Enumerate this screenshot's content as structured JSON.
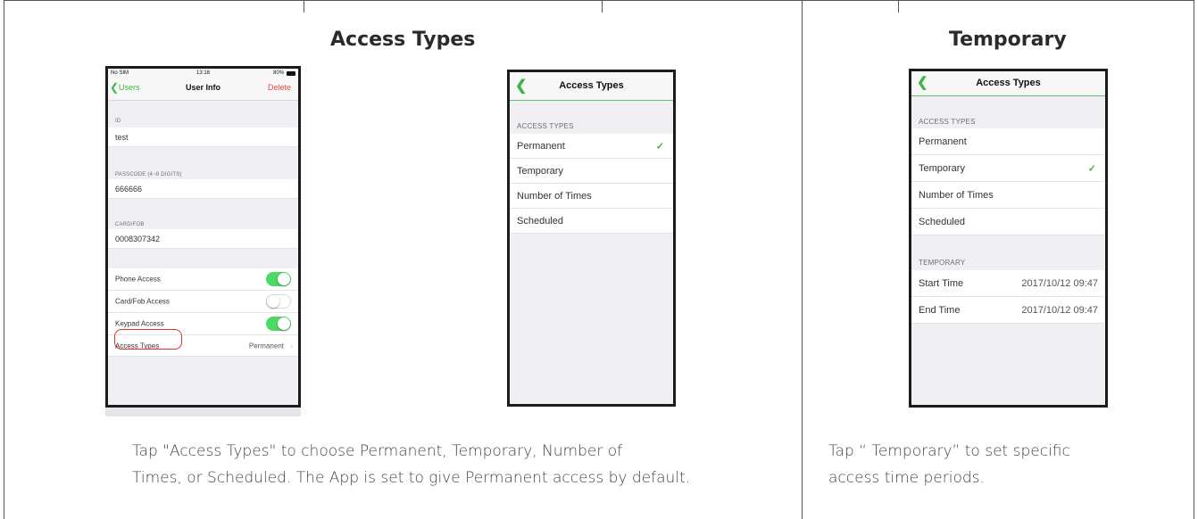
{
  "left_section": {
    "title": "Access Types",
    "caption_line1": "Tap \"Access Types\" to choose Permanent, Temporary, Number of",
    "caption_line2": "Times, or Scheduled. The App is set to give Permanent access by default.",
    "phone1": {
      "status_carrier": "No SIM",
      "status_time": "13:18",
      "status_battery": "80%",
      "nav_back": "Users",
      "nav_title": "User Info",
      "nav_action": "Delete",
      "id_header": "ID",
      "id_value": "test",
      "passcode_header": "PASSCODE (4~8 DIGITS)",
      "passcode_value": "666666",
      "card_header": "CARD/FOB",
      "card_value": "0008307342",
      "phone_access": "Phone Access",
      "card_access": "Card/Fob Access",
      "keypad_access": "Keypad Access",
      "access_types_label": "Access Types",
      "access_types_value": "Permanent",
      "toggles": {
        "phone_access": true,
        "card_access": false,
        "keypad_access": true
      }
    },
    "phone2": {
      "nav_title": "Access Types",
      "section_header": "ACCESS TYPES",
      "options": [
        "Permanent",
        "Temporary",
        "Number of Times",
        "Scheduled"
      ],
      "selected": "Permanent"
    }
  },
  "right_section": {
    "title": "Temporary",
    "caption_line1": "Tap “ Temporary”  to set specific",
    "caption_line2": "access time periods.",
    "phone3": {
      "nav_title": "Access Types",
      "section_header": "ACCESS TYPES",
      "options": [
        "Permanent",
        "Temporary",
        "Number of Times",
        "Scheduled"
      ],
      "selected": "Temporary",
      "temp_header": "TEMPORARY",
      "start_label": "Start Time",
      "start_value": "2017/10/12 09:47",
      "end_label": "End Time",
      "end_value": "2017/10/12 09:47"
    }
  },
  "colors": {
    "accent_green": "#3cb54a",
    "toggle_on": "#4cd964",
    "delete_red": "#e5484d",
    "highlight_red": "#d9332b"
  }
}
